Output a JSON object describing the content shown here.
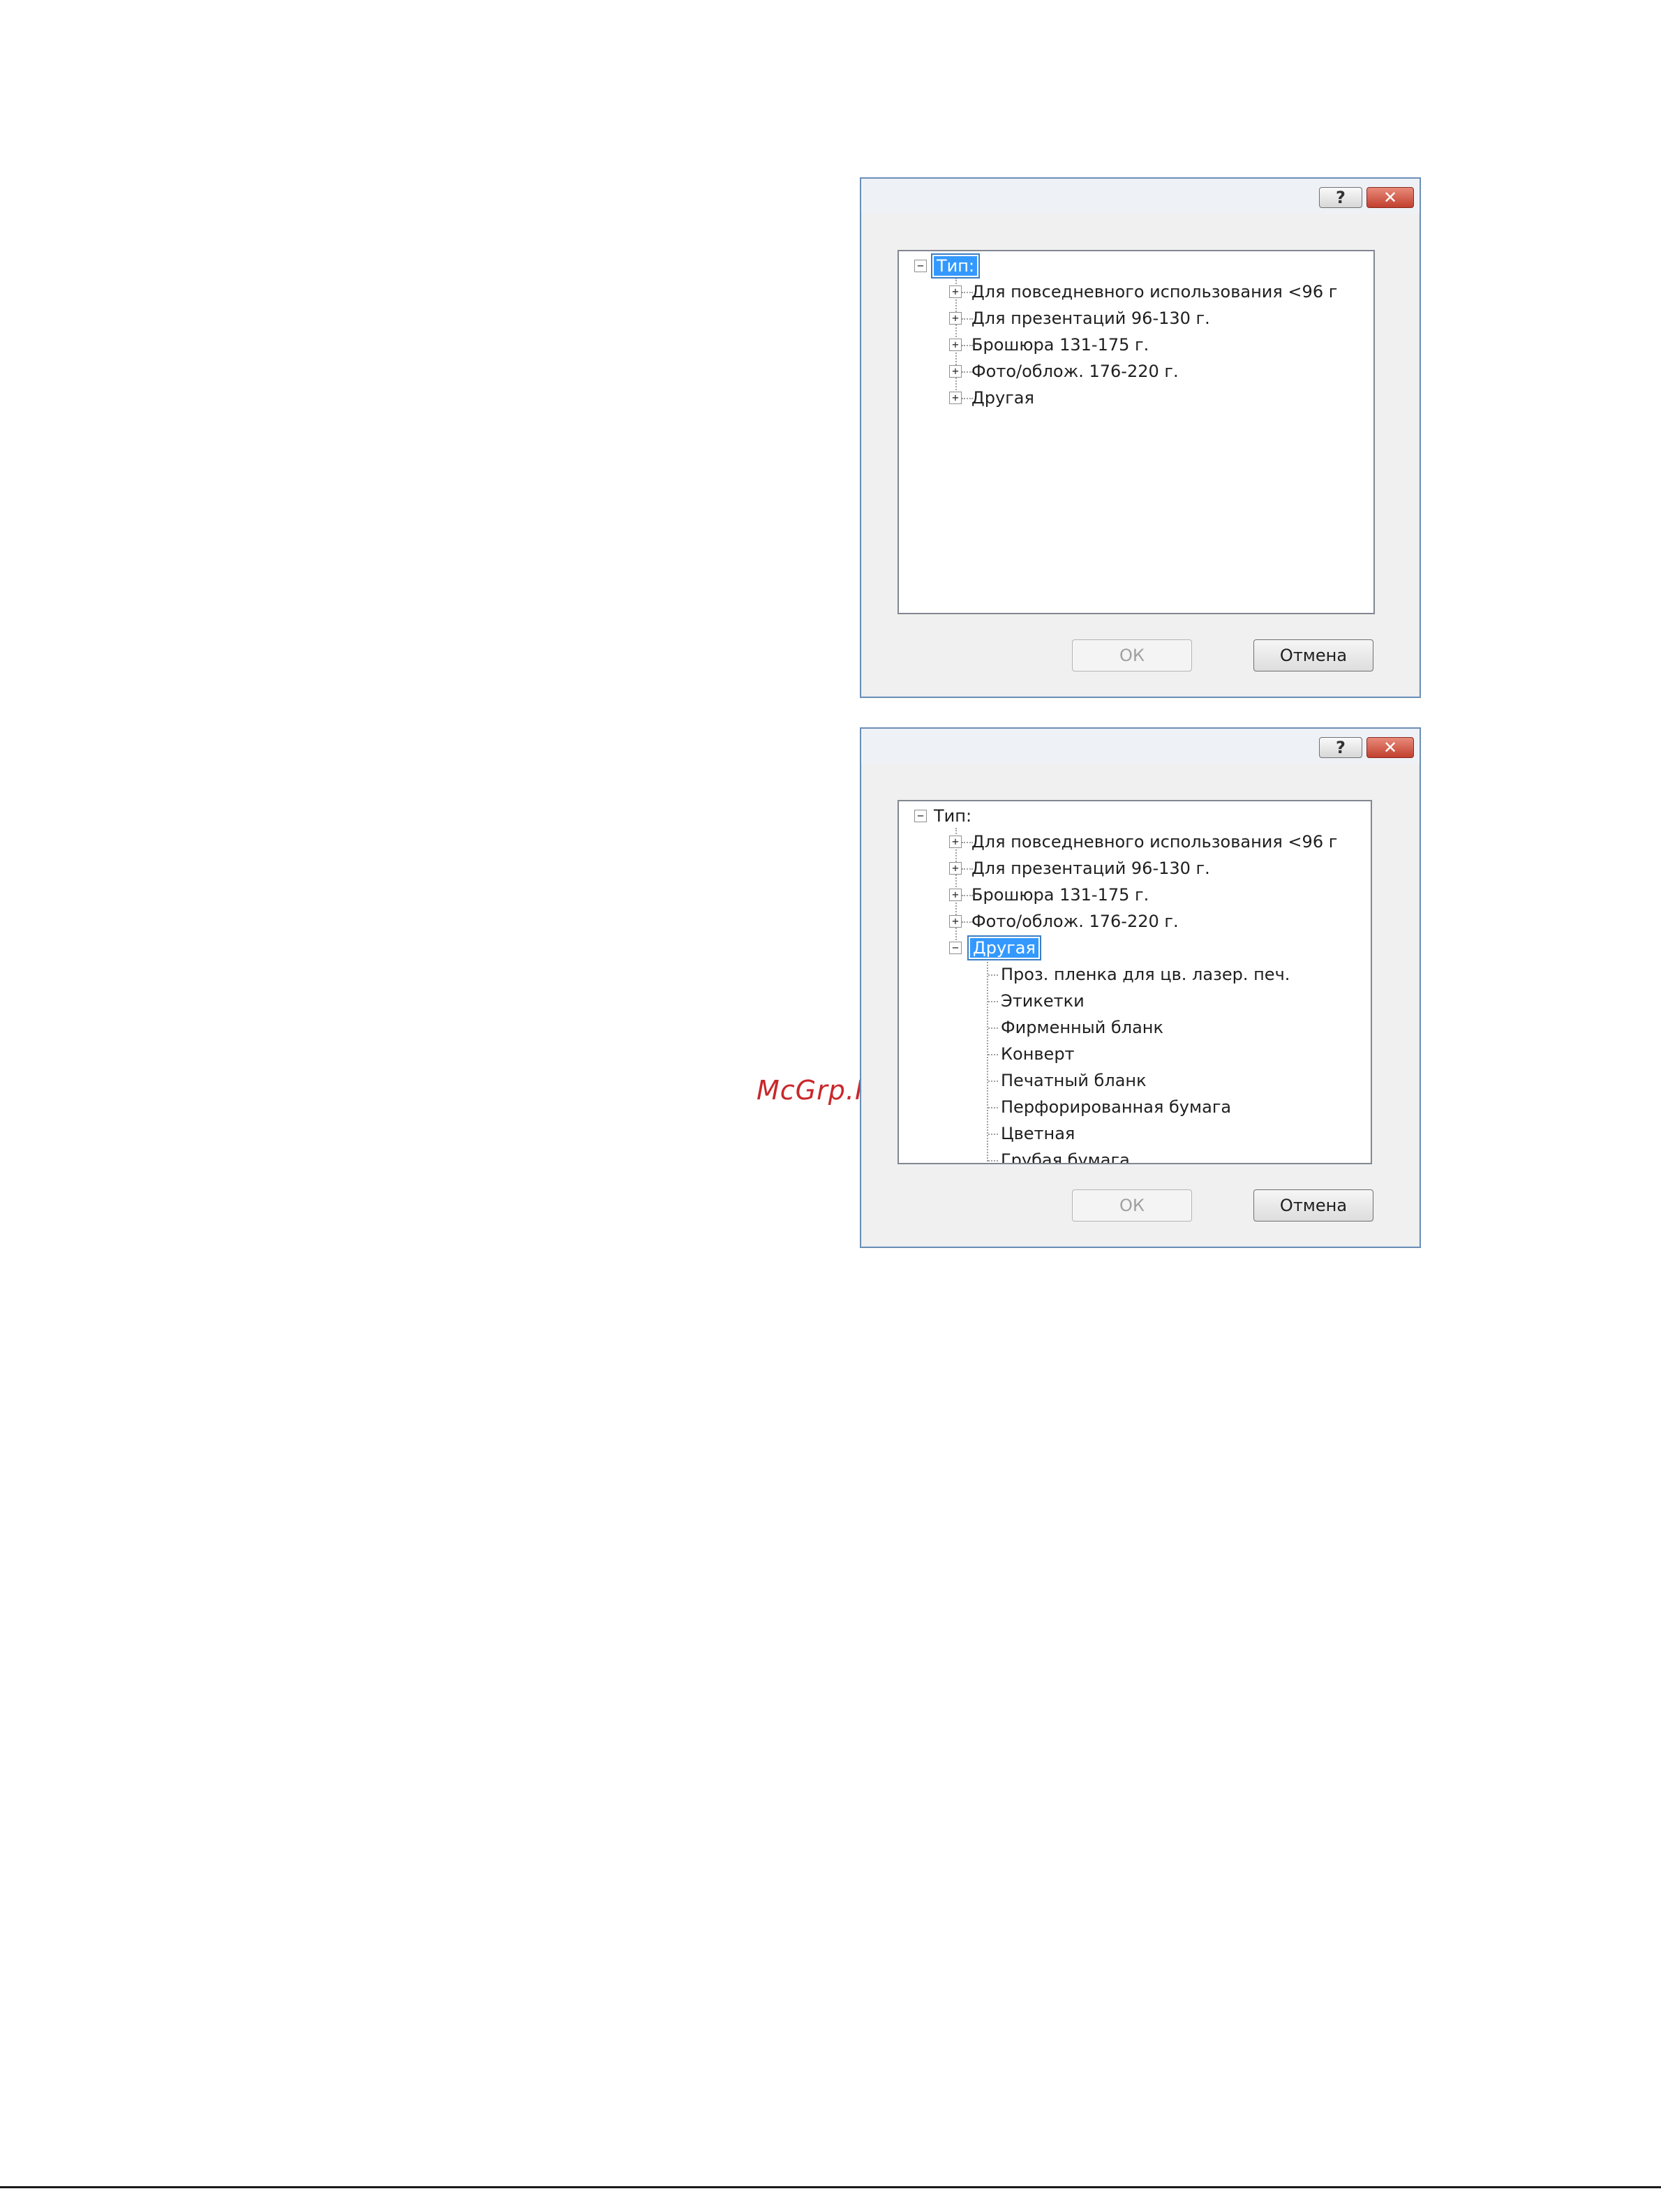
{
  "watermark": "McGrp.Ru",
  "dialog1": {
    "help_label": "?",
    "close_label": "✕",
    "root_label": "Тип:",
    "items": [
      "Для повседневного использования <96 г",
      "Для презентаций 96-130 г.",
      "Брошюра 131-175 г.",
      "Фото/облож. 176-220 г.",
      "Другая"
    ],
    "ok_label": "ОК",
    "cancel_label": "Отмена"
  },
  "dialog2": {
    "help_label": "?",
    "close_label": "✕",
    "root_label": "Тип:",
    "items": [
      "Для повседневного использования <96 г",
      "Для презентаций 96-130 г.",
      "Брошюра 131-175 г.",
      "Фото/облож. 176-220 г.",
      "Другая"
    ],
    "subitems": [
      "Проз. пленка для цв. лазер. печ.",
      "Этикетки",
      "Фирменный бланк",
      "Конверт",
      "Печатный бланк",
      "Перфорированная бумага",
      "Цветная",
      "Грубая бумага"
    ],
    "ok_label": "ОК",
    "cancel_label": "Отмена"
  }
}
